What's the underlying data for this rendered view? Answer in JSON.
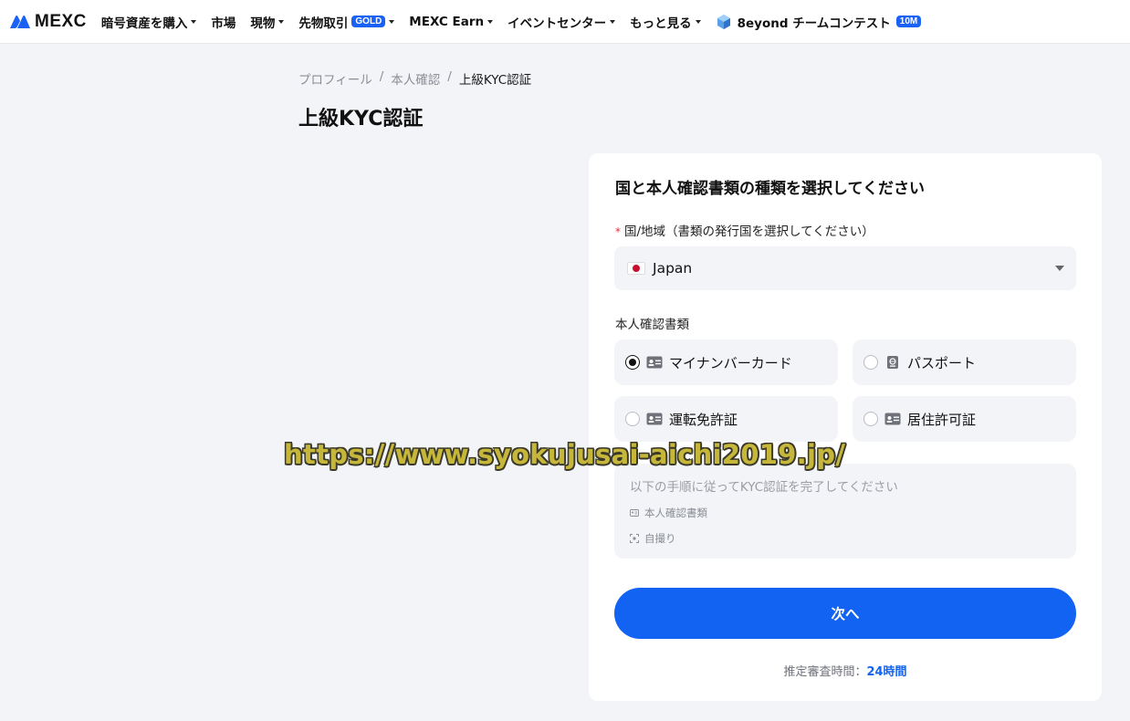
{
  "nav": {
    "logo_text": "MEXC",
    "items": [
      {
        "label": "暗号資産を購入",
        "has_caret": true
      },
      {
        "label": "市場",
        "has_caret": false
      },
      {
        "label": "現物",
        "has_caret": true
      },
      {
        "label": "先物取引",
        "badge": "GOLD",
        "has_caret": true
      },
      {
        "label": "MEXC Earn",
        "has_caret": true
      },
      {
        "label": "イベントセンター",
        "has_caret": true
      },
      {
        "label": "もっと見る",
        "has_caret": true
      }
    ],
    "contest": {
      "label": "8eyond チームコンテスト",
      "badge": "10M"
    }
  },
  "breadcrumb": {
    "items": [
      "プロフィール",
      "本人確認",
      "上級KYC認証"
    ],
    "separator": "/"
  },
  "page_title": "上級KYC認証",
  "form": {
    "heading": "国と本人確認書類の種類を選択してください",
    "country_label": "国/地域（書類の発行国を選択してください）",
    "required_mark": "*",
    "country_value": "Japan",
    "doc_type_label": "本人確認書類",
    "doc_options": [
      {
        "label": "マイナンバーカード",
        "selected": true,
        "icon": "id-card-icon"
      },
      {
        "label": "パスポート",
        "selected": false,
        "icon": "passport-icon"
      },
      {
        "label": "運転免許証",
        "selected": false,
        "icon": "id-card-icon"
      },
      {
        "label": "居住許可証",
        "selected": false,
        "icon": "id-card-icon"
      }
    ],
    "steps_intro": "以下の手順に従ってKYC認証を完了してください",
    "steps": [
      {
        "label": "本人確認書類",
        "icon": "id-card-icon"
      },
      {
        "label": "自撮り",
        "icon": "face-scan-icon"
      }
    ],
    "next_label": "次へ",
    "review_prefix": "推定審査時間：",
    "review_time": "24時間"
  },
  "watermark": "https://www.syokujusai-aichi2019.jp/",
  "colors": {
    "accent": "#1263f1",
    "badge_blue": "#1a62f5",
    "background": "#f3f4f7",
    "required": "#e0343a"
  }
}
